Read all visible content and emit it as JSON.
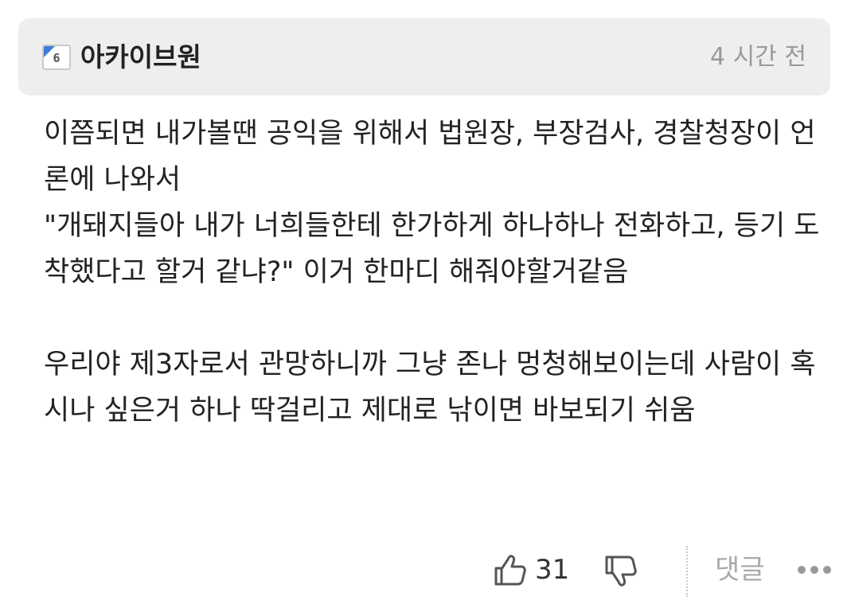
{
  "header": {
    "level": "6",
    "author": "아카이브원",
    "time": "4 시간 전"
  },
  "content": {
    "paragraphs": [
      "이쯤되면 내가볼땐 공익을 위해서 법원장, 부장검사, 경찰청장이 언론에 나와서",
      "\"개돼지들아 내가 너희들한테 한가하게 하나하나 전화하고, 등기 도착했다고 할거 같냐?\" 이거 한마디 해줘야할거같음",
      "우리야 제3자로서 관망하니까 그냥 존나 멍청해보이는데 사람이 혹시나 싶은거 하나 딱걸리고 제대로 낚이면 바보되기 쉬움"
    ]
  },
  "footer": {
    "like_count": "31",
    "comment_label": "댓글"
  },
  "icons": {
    "level_badge": "level-badge-icon",
    "like": "thumbs-up-icon",
    "dislike": "thumbs-down-icon",
    "more": "more-dots-icon"
  },
  "colors": {
    "header_background": "#eeeeee",
    "badge_accent": "#3d7ed8",
    "muted_text": "#999999",
    "body_text": "#222222"
  }
}
